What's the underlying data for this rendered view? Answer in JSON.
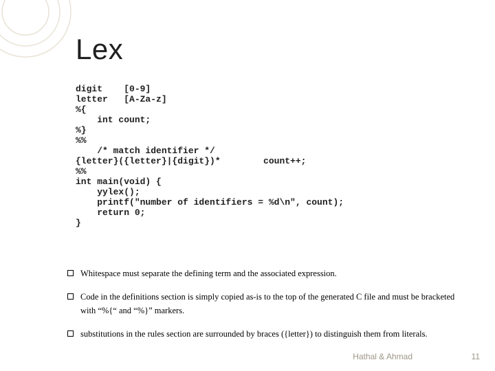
{
  "title": "Lex",
  "code": "digit    [0-9]\nletter   [A-Za-z]\n%{\n    int count;\n%}\n%%\n    /* match identifier */\n{letter}({letter}|{digit})*        count++;\n%%\nint main(void) {\n    yylex();\n    printf(\"number of identifiers = %d\\n\", count);\n    return 0;\n}",
  "bullets": [
    "Whitespace must separate the defining term and the associated expression.",
    "Code in the definitions section is simply copied as-is to the top of the generated C file and must be bracketed with “%{“ and “%}” markers.",
    "substitutions in the rules section are surrounded by braces ({letter}) to distinguish them from literals."
  ],
  "footer": {
    "author": "Hathal & Ahmad",
    "page": "11"
  }
}
